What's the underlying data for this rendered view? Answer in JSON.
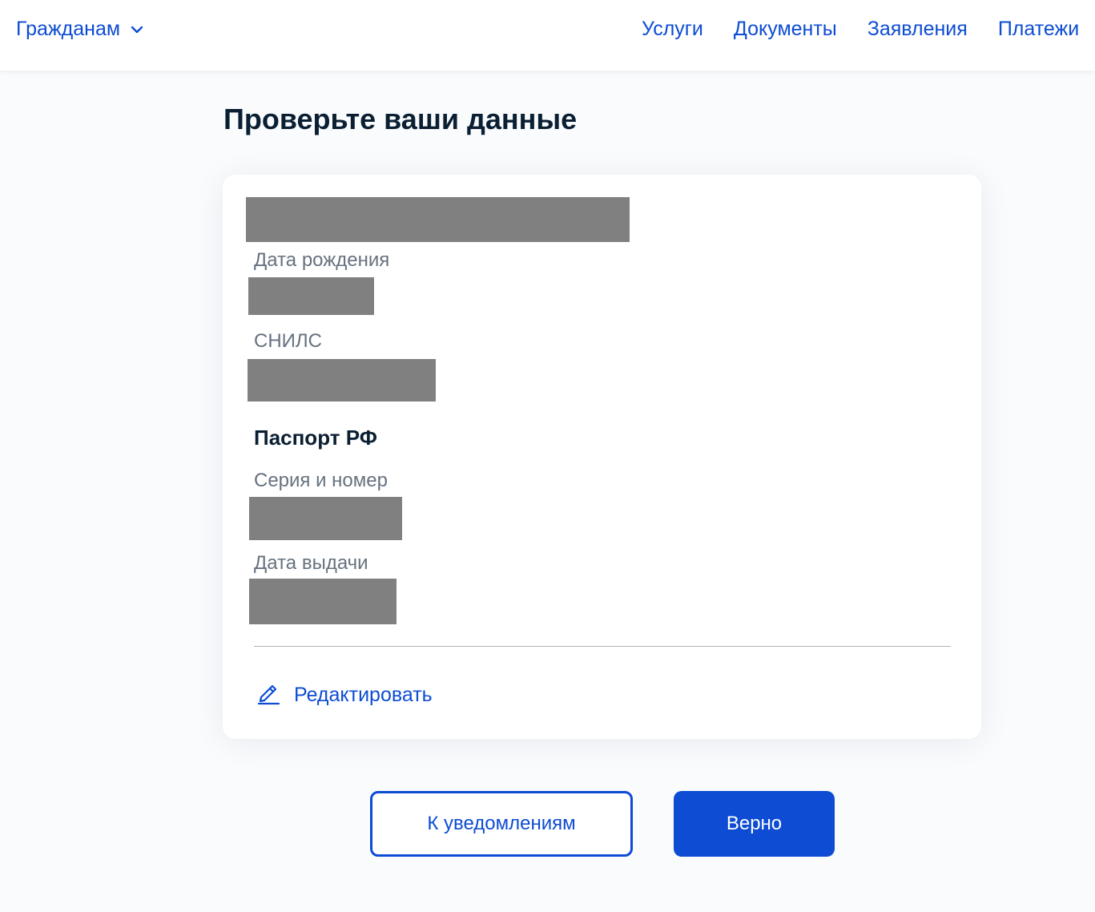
{
  "header": {
    "audience_label": "Гражданам",
    "nav": [
      {
        "label": "Услуги"
      },
      {
        "label": "Документы"
      },
      {
        "label": "Заявления"
      },
      {
        "label": "Платежи"
      }
    ]
  },
  "main": {
    "title": "Проверьте ваши данные",
    "fields": {
      "birth_date_label": "Дата рождения",
      "snils_label": "СНИЛС"
    },
    "passport": {
      "title": "Паспорт РФ",
      "series_number_label": "Серия и номер",
      "issue_date_label": "Дата выдачи"
    },
    "edit_label": "Редактировать"
  },
  "actions": {
    "back_label": "К уведомлениям",
    "confirm_label": "Верно"
  },
  "colors": {
    "accent": "#0d4cd3",
    "text_primary": "#0b1f33",
    "text_secondary": "#66727f",
    "redaction": "#808080",
    "page_bg": "#f9fbfd"
  },
  "icons": {
    "audience_chevron": "chevron-down-icon",
    "edit": "pencil-icon"
  }
}
